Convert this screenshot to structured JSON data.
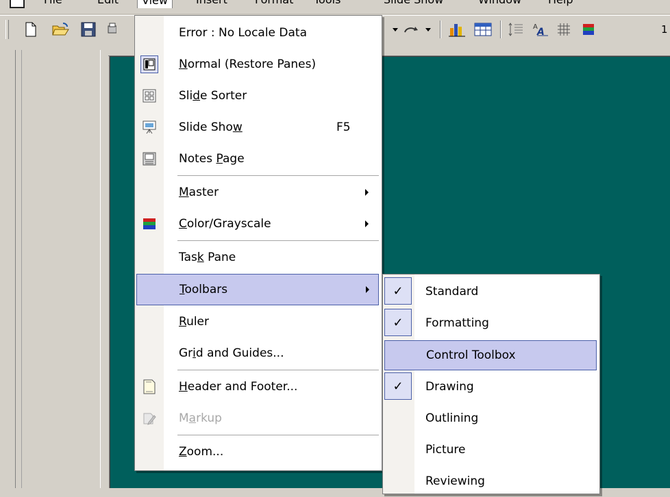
{
  "menubar": {
    "items": [
      "File",
      "Edit",
      "View",
      "Insert",
      "Format",
      "Tools",
      "Slide Show",
      "Window",
      "Help"
    ]
  },
  "toolbar": {
    "zoom_partial": "1"
  },
  "view_menu": {
    "items": [
      {
        "label": "Error : No Locale Data",
        "icon": "",
        "shortcut": "",
        "submenu": false
      },
      {
        "label_pre": "",
        "label_u": "N",
        "label_post": "ormal (Restore Panes)",
        "icon": "normal-view-icon"
      },
      {
        "label_pre": "Sli",
        "label_u": "d",
        "label_post": "e Sorter",
        "icon": "slide-sorter-icon"
      },
      {
        "label_pre": "Slide Sho",
        "label_u": "w",
        "label_post": "",
        "shortcut": "F5",
        "icon": "slide-show-icon"
      },
      {
        "label_pre": "Notes ",
        "label_u": "P",
        "label_post": "age",
        "icon": "notes-page-icon"
      },
      {
        "label_pre": "",
        "label_u": "M",
        "label_post": "aster",
        "submenu": true
      },
      {
        "label_pre": "",
        "label_u": "C",
        "label_post": "olor/Grayscale",
        "submenu": true,
        "icon": "color-grayscale-icon"
      },
      {
        "label_pre": "Tas",
        "label_u": "k",
        "label_post": " Pane"
      },
      {
        "label_pre": "",
        "label_u": "T",
        "label_post": "oolbars",
        "submenu": true,
        "highlighted": true
      },
      {
        "label_pre": "",
        "label_u": "R",
        "label_post": "uler"
      },
      {
        "label_pre": "Gr",
        "label_u": "i",
        "label_post": "d and Guides..."
      },
      {
        "label_pre": "",
        "label_u": "H",
        "label_post": "eader and Footer...",
        "icon": "header-footer-icon"
      },
      {
        "label_pre": "M",
        "label_u": "a",
        "label_post": "rkup",
        "disabled": true,
        "icon": "markup-icon"
      },
      {
        "label_pre": "",
        "label_u": "Z",
        "label_post": "oom..."
      }
    ]
  },
  "toolbars_submenu": {
    "items": [
      {
        "label": "Standard",
        "checked": true
      },
      {
        "label": "Formatting",
        "checked": true
      },
      {
        "label": "Control Toolbox",
        "checked": false,
        "highlighted": true
      },
      {
        "label": "Drawing",
        "checked": true
      },
      {
        "label": "Outlining",
        "checked": false
      },
      {
        "label": "Picture",
        "checked": false
      },
      {
        "label": "Reviewing",
        "checked": false
      }
    ],
    "check_glyph": "✓"
  }
}
